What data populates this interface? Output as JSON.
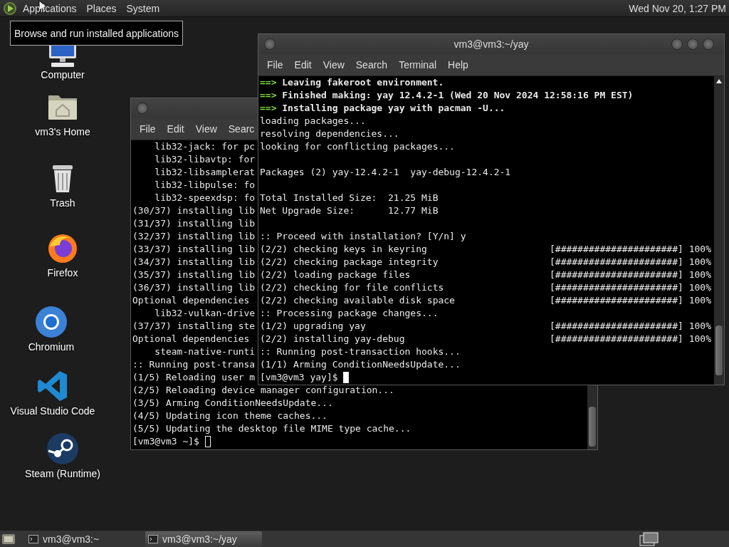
{
  "top_panel": {
    "menus": [
      "Applications",
      "Places",
      "System"
    ],
    "clock": "Wed Nov 20, 1:27 PM"
  },
  "tooltip": "Browse and run installed applications",
  "desktop_icons": [
    {
      "label": "Computer",
      "kind": "computer"
    },
    {
      "label": "vm3's Home",
      "kind": "home"
    },
    {
      "label": "Trash",
      "kind": "trash"
    },
    {
      "label": "Firefox",
      "kind": "firefox"
    },
    {
      "label": "Chromium",
      "kind": "chromium"
    },
    {
      "label": "Visual Studio Code",
      "kind": "vscode"
    },
    {
      "label": "Steam (Runtime)",
      "kind": "steam"
    }
  ],
  "windows": [
    {
      "focused": false,
      "menus": [
        "File",
        "Edit",
        "View",
        "Searc"
      ],
      "lines": [
        {
          "kind": "plain",
          "text": "    lib32-jack: for pc"
        },
        {
          "kind": "plain",
          "text": "    lib32-libavtp: for"
        },
        {
          "kind": "plain",
          "text": "    lib32-libsamplerat"
        },
        {
          "kind": "plain",
          "text": "    lib32-libpulse: fo"
        },
        {
          "kind": "plain",
          "text": "    lib32-speexdsp: fo"
        },
        {
          "kind": "plain",
          "text": "(30/37) installing lib"
        },
        {
          "kind": "plain",
          "text": "(31/37) installing lib"
        },
        {
          "kind": "plain",
          "text": "(32/37) installing lib"
        },
        {
          "kind": "plain",
          "text": "(33/37) installing lib"
        },
        {
          "kind": "plain",
          "text": "(34/37) installing lib"
        },
        {
          "kind": "plain",
          "text": "(35/37) installing lib"
        },
        {
          "kind": "plain",
          "text": "(36/37) installing lib"
        },
        {
          "kind": "plain",
          "text": "Optional dependencies"
        },
        {
          "kind": "plain",
          "text": "    lib32-vulkan-drive"
        },
        {
          "kind": "plain",
          "text": "(37/37) installing ste"
        },
        {
          "kind": "plain",
          "text": "Optional dependencies"
        },
        {
          "kind": "plain",
          "text": "    steam-native-runti"
        },
        {
          "kind": "plain",
          "text": ":: Running post-transa"
        },
        {
          "kind": "plain",
          "text": "(1/5) Reloading user m"
        },
        {
          "kind": "plain",
          "text": "(2/5) Reloading device manager configuration..."
        },
        {
          "kind": "plain",
          "text": "(3/5) Arming ConditionNeedsUpdate..."
        },
        {
          "kind": "plain",
          "text": "(4/5) Updating icon theme caches..."
        },
        {
          "kind": "plain",
          "text": "(5/5) Updating the desktop file MIME type cache..."
        },
        {
          "kind": "prompt",
          "text": "[vm3@vm3 ~]$"
        }
      ]
    },
    {
      "title": "vm3@vm3:~/yay",
      "focused": true,
      "menus": [
        "File",
        "Edit",
        "View",
        "Search",
        "Terminal",
        "Help"
      ],
      "lines": [
        {
          "kind": "arrow",
          "prefix": "==>",
          "text": "Leaving fakeroot environment."
        },
        {
          "kind": "arrow",
          "prefix": "==>",
          "text": "Finished making: yay 12.4.2-1 (Wed 20 Nov 2024 12:58:16 PM EST)"
        },
        {
          "kind": "arrow",
          "prefix": "==>",
          "text": "Installing package yay with pacman -U..."
        },
        {
          "kind": "plain",
          "text": "loading packages..."
        },
        {
          "kind": "plain",
          "text": "resolving dependencies..."
        },
        {
          "kind": "plain",
          "text": "looking for conflicting packages..."
        },
        {
          "kind": "blank"
        },
        {
          "kind": "plain",
          "text": "Packages (2) yay-12.4.2-1  yay-debug-12.4.2-1"
        },
        {
          "kind": "blank"
        },
        {
          "kind": "plain",
          "text": "Total Installed Size:  21.25 MiB"
        },
        {
          "kind": "plain",
          "text": "Net Upgrade Size:      12.77 MiB"
        },
        {
          "kind": "blank"
        },
        {
          "kind": "plain",
          "text": ":: Proceed with installation? [Y/n] y"
        },
        {
          "kind": "progress",
          "text": "(2/2) checking keys in keyring",
          "bar": "[######################] 100%"
        },
        {
          "kind": "progress",
          "text": "(2/2) checking package integrity",
          "bar": "[######################] 100%"
        },
        {
          "kind": "progress",
          "text": "(2/2) loading package files",
          "bar": "[######################] 100%"
        },
        {
          "kind": "progress",
          "text": "(2/2) checking for file conflicts",
          "bar": "[######################] 100%"
        },
        {
          "kind": "progress",
          "text": "(2/2) checking available disk space",
          "bar": "[######################] 100%"
        },
        {
          "kind": "plain",
          "text": ":: Processing package changes..."
        },
        {
          "kind": "progress",
          "text": "(1/2) upgrading yay",
          "bar": "[######################] 100%"
        },
        {
          "kind": "progress",
          "text": "(2/2) installing yay-debug",
          "bar": "[######################] 100%"
        },
        {
          "kind": "plain",
          "text": ":: Running post-transaction hooks..."
        },
        {
          "kind": "plain",
          "text": "(1/1) Arming ConditionNeedsUpdate..."
        },
        {
          "kind": "prompt",
          "text": "[vm3@vm3 yay]$"
        }
      ]
    }
  ],
  "taskbar": {
    "tasks": [
      {
        "label": "vm3@vm3:~",
        "selected": false
      },
      {
        "label": "vm3@vm3:~/yay",
        "selected": true
      }
    ]
  }
}
